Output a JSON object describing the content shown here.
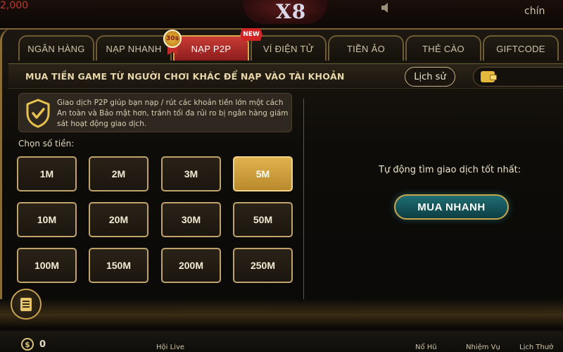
{
  "topbar": {
    "balance": "2,000",
    "logo_text": "X8",
    "right_text": "chín"
  },
  "tabs": [
    {
      "label": "NGÂN HÀNG",
      "active": false
    },
    {
      "label": "NẠP NHANH",
      "active": false,
      "badge": "30s"
    },
    {
      "label": "NẠP P2P",
      "active": true,
      "badge": "NEW"
    },
    {
      "label": "VÍ ĐIỆN TỬ",
      "active": false
    },
    {
      "label": "TIỀN ẢO",
      "active": false
    },
    {
      "label": "THẺ CÀO",
      "active": false
    },
    {
      "label": "GIFTCODE",
      "active": false
    }
  ],
  "header": {
    "title": "MUA TIỀN GAME TỪ NGƯỜI CHƠI KHÁC ĐỂ NẠP VÀO TÀI KHOẢN",
    "history_label": "Lịch sử",
    "wallet_icon": "wallet-icon"
  },
  "notice": {
    "text": "Giao dịch P2P giúp bạn nạp / rút các khoản tiền lớn một cách An toàn và Bảo mật hơn, tránh tối đa rủi ro bị ngân hàng giám sát hoạt động giao dịch.",
    "icon": "shield-check-icon"
  },
  "amount_section": {
    "label": "Chọn số tiền:",
    "options": [
      "1M",
      "2M",
      "3M",
      "5M",
      "10M",
      "20M",
      "30M",
      "50M",
      "100M",
      "150M",
      "200M",
      "250M"
    ],
    "selected": "5M"
  },
  "auto_match": {
    "text": "Tự động tìm giao dịch tốt nhất:",
    "button_label": "MUA NHANH"
  },
  "bottom": {
    "coin_balance": "0",
    "labels": [
      "Hội Live",
      "Nổ Hũ",
      "Nhiệm Vụ",
      "Lịch Thưở"
    ]
  },
  "colors": {
    "accent_gold": "#bfa36a",
    "selected_gold": "#d4a63f",
    "active_tab_red": "#b52b28",
    "buy_button_teal": "#165a5e"
  }
}
